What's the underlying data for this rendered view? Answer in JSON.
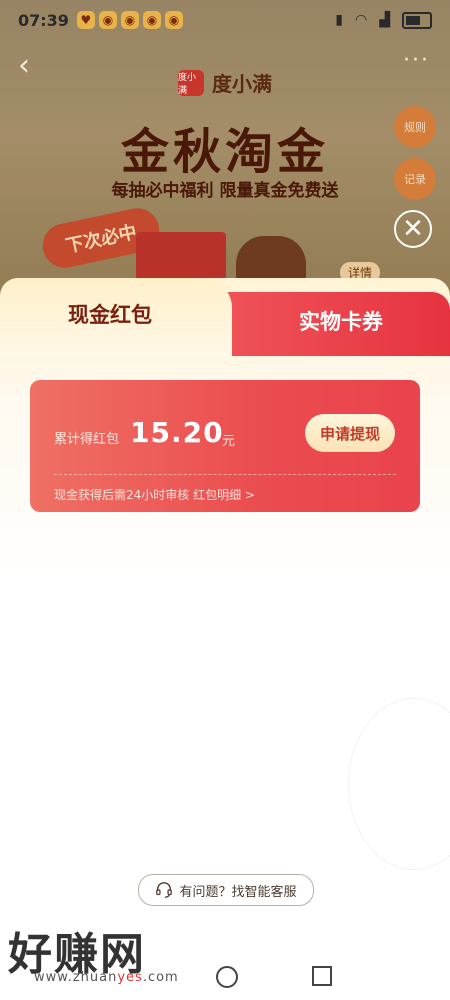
{
  "status_bar": {
    "time": "07:39"
  },
  "promo": {
    "brand_logo_text": "度小满",
    "brand_name": "度小满",
    "title": "金秋淘金",
    "subtitle": "每抽必中福利 限量真金免费送",
    "next_badge": "下次必中",
    "side_pill_1": "规则",
    "side_pill_2": "记录",
    "detail_chip": "详情",
    "close_symbol": "✕"
  },
  "tabs": {
    "cash": "现金红包",
    "card": "实物卡券"
  },
  "cash_card": {
    "label": "累计得红包",
    "amount": "15.20",
    "unit": "元",
    "withdraw_button": "申请提现",
    "note": "现金获得后需24小时审核  红包明细 >"
  },
  "help": {
    "label": "有问题？找智能客服"
  },
  "watermark": {
    "text": "好赚网",
    "url_prefix": "www.zhuan",
    "url_highlight": "yes",
    "url_suffix": ".com"
  },
  "colors": {
    "accent_red": "#e9434d",
    "tab_text_dark": "#7b1f0f",
    "button_gold": "#fbe2b4"
  }
}
